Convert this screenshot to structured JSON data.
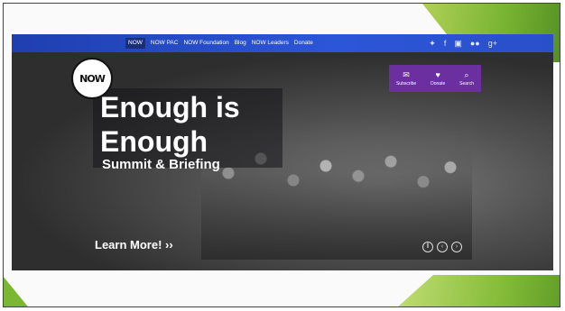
{
  "nav": {
    "links": [
      {
        "label": "NOW"
      },
      {
        "label": "NOW PAC"
      },
      {
        "label": "NOW Foundation"
      },
      {
        "label": "Blog"
      },
      {
        "label": "NOW Leaders"
      },
      {
        "label": "Donate"
      }
    ],
    "social_icons": [
      "twitter-icon",
      "facebook-icon",
      "instagram-icon",
      "flickr-icon",
      "google-plus-icon"
    ]
  },
  "logo": {
    "text": "NOW"
  },
  "hero": {
    "headline_line1": "Enough is",
    "headline_line2": "Enough",
    "subheadline": "Summit & Briefing",
    "cta": "Learn More! ››"
  },
  "actions": [
    {
      "label": "Subscribe",
      "icon": "mail-icon"
    },
    {
      "label": "Donate",
      "icon": "heart-icon"
    },
    {
      "label": "Search",
      "icon": "search-icon"
    }
  ],
  "slider": {
    "controls": [
      "pause-icon",
      "prev-icon",
      "next-icon"
    ]
  },
  "colors": {
    "nav_blue": "#2c56d8",
    "action_purple": "#6b2fa0",
    "accent_green": "#7ab532"
  }
}
